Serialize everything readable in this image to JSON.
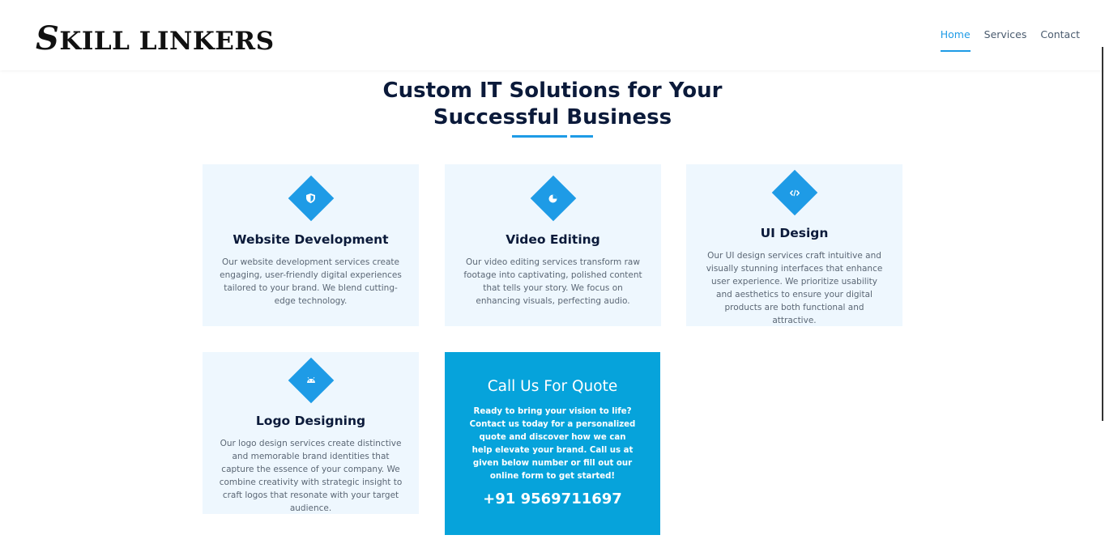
{
  "header": {
    "logo_first": "S",
    "logo_rest": "KILL LINKERS",
    "nav": [
      {
        "label": "Home"
      },
      {
        "label": "Services"
      },
      {
        "label": "Contact"
      }
    ]
  },
  "section": {
    "title_line1": "Custom IT Solutions for Your",
    "title_line2": "Successful Business"
  },
  "services": [
    {
      "icon": "shield-icon",
      "title": "Website Development",
      "description": "Our website development services create engaging, user-friendly digital experiences tailored to your brand. We blend cutting-edge technology."
    },
    {
      "icon": "chart-pie-icon",
      "title": "Video Editing",
      "description": "Our video editing services transform raw footage into captivating, polished content that tells your story. We focus on enhancing visuals, perfecting audio."
    },
    {
      "icon": "code-icon",
      "title": "UI Design",
      "description": "Our UI design services craft intuitive and visually stunning interfaces that enhance user experience. We prioritize usability and aesthetics to ensure your digital products are both functional and attractive."
    },
    {
      "icon": "android-icon",
      "title": "Logo Designing",
      "description": "Our logo design services create distinctive and memorable brand identities that capture the essence of your company. We combine creativity with strategic insight to craft logos that resonate with your target audience."
    }
  ],
  "quote": {
    "title": "Call Us For Quote",
    "text": "Ready to bring your vision to life? Contact us today for a personalized quote and discover how we can help elevate your brand. Call us at given below number or fill out our online form to get started!",
    "phone": "+91 9569711697"
  },
  "colors": {
    "accent": "#1e9be6",
    "quote_bg": "#06a3db",
    "card_bg": "#eef7fe",
    "heading": "#0b1a3a"
  }
}
